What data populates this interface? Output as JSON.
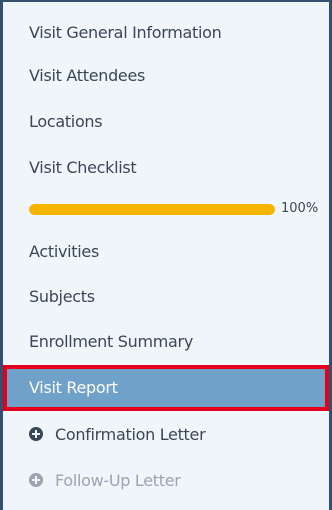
{
  "colors": {
    "progress_fill": "#f7b500",
    "active_background": "#6fa1c9",
    "highlight_outline": "#e3001b"
  },
  "nav": {
    "items": [
      {
        "label": "Visit General Information"
      },
      {
        "label": "Visit Attendees"
      },
      {
        "label": "Locations"
      },
      {
        "label": "Visit Checklist"
      },
      {
        "label": "Activities"
      },
      {
        "label": "Subjects"
      },
      {
        "label": "Enrollment Summary"
      },
      {
        "label": "Visit Report"
      }
    ],
    "active_item": "Visit Report"
  },
  "checklist_progress": {
    "percent": 100,
    "label": "100%"
  },
  "actions": [
    {
      "label": "Confirmation Letter",
      "icon": "plus-circle-icon",
      "enabled": true
    },
    {
      "label": "Follow-Up Letter",
      "icon": "plus-circle-icon",
      "enabled": false
    }
  ]
}
